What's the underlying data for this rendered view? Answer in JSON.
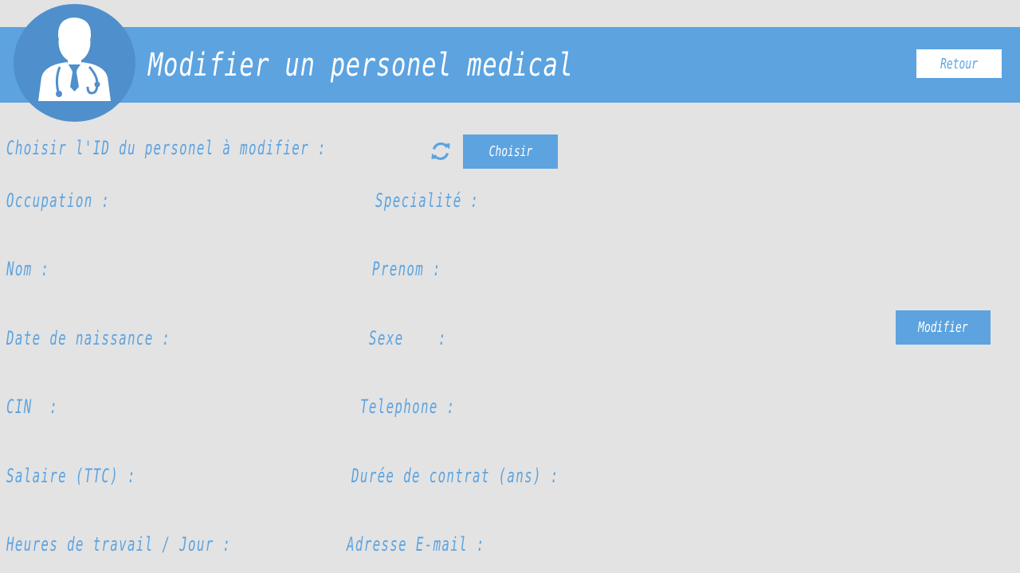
{
  "header": {
    "title": "Modifier un personel medical",
    "avatar_icon": "doctor-icon",
    "back_label": "Retour"
  },
  "selector": {
    "label": "Choisir l'ID du personel à modifier :",
    "refresh_icon": "refresh-icon",
    "choose_label": "Choisir"
  },
  "form": {
    "occupation": "Occupation :",
    "specialite": "Specialité :",
    "nom": "Nom :",
    "prenom": "Prenom :",
    "date_naissance": "Date de naissance :",
    "sexe": "Sexe    :",
    "cin": "CIN  :",
    "telephone": "Telephone :",
    "salaire": "Salaire (TTC) :",
    "duree_contrat": "Durée de contrat (ans) :",
    "heures_travail": "Heures de travail / Jour :",
    "email": "Adresse E-mail :"
  },
  "actions": {
    "modify_label": "Modifier"
  },
  "colors": {
    "accent": "#5ca3e0",
    "accent_dark": "#4f8fcb",
    "background": "#e3e3e3",
    "text_light": "#ffffff"
  }
}
